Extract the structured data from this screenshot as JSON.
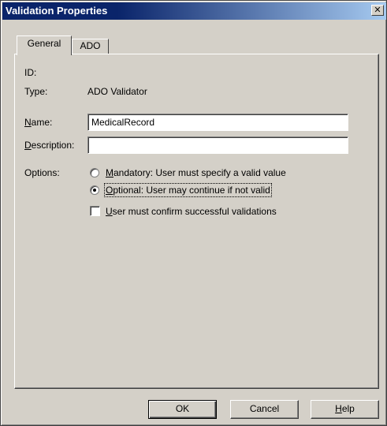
{
  "window": {
    "title": "Validation Properties",
    "close_glyph": "✕"
  },
  "tabs": [
    {
      "label": "General",
      "active": true
    },
    {
      "label": "ADO",
      "active": false
    }
  ],
  "general": {
    "id_label": "ID:",
    "id_value": "",
    "type_label": "Type:",
    "type_value": "ADO Validator",
    "name_label_access": "N",
    "name_label_rest": "ame:",
    "name_value": "MedicalRecord",
    "description_label_access": "D",
    "description_label_rest": "escription:",
    "description_value": "",
    "options_label": "Options:",
    "options": [
      {
        "access": "M",
        "rest": "andatory: User must specify a valid value",
        "selected": false
      },
      {
        "access": "O",
        "rest": "ptional: User may continue if not valid",
        "selected": true
      }
    ],
    "confirm_checkbox": {
      "access": "U",
      "rest": "ser must confirm successful validations",
      "checked": false
    }
  },
  "buttons": {
    "ok": "OK",
    "cancel": "Cancel",
    "help_access": "H",
    "help_rest": "elp"
  }
}
